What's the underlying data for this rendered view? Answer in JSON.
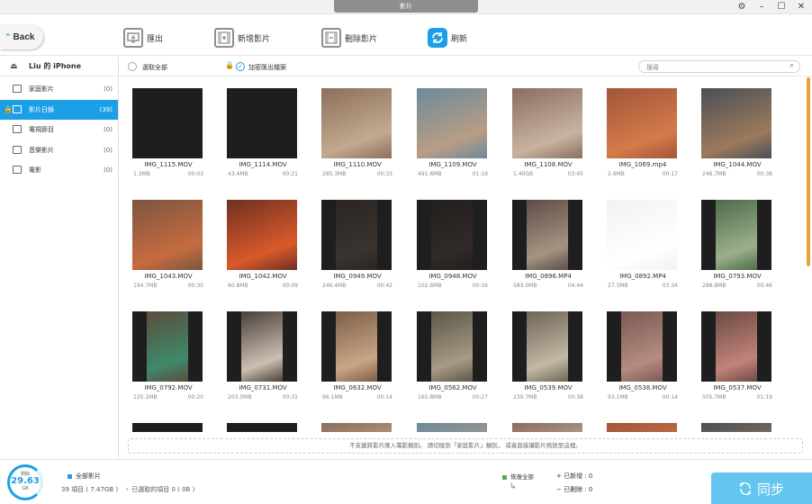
{
  "window": {
    "title": "影片"
  },
  "toolbar": {
    "back": "Back",
    "export": "匯出",
    "add": "新增影片",
    "delete": "刪除影片",
    "refresh": "刷新"
  },
  "sidebar": {
    "device": "Liu 的 iPhone",
    "items": [
      {
        "label": "家庭影片",
        "count": "(0)",
        "icon": "home-video-icon"
      },
      {
        "label": "影片日錄",
        "count": "(39)",
        "icon": "camera-roll-icon"
      },
      {
        "label": "電視節目",
        "count": "(0)",
        "icon": "tv-icon"
      },
      {
        "label": "音樂影片",
        "count": "(0)",
        "icon": "music-video-icon"
      },
      {
        "label": "電影",
        "count": "(0)",
        "icon": "movie-icon"
      }
    ]
  },
  "header": {
    "select_all": "選取全部",
    "encrypted": "加密匯出檔案",
    "search_placeholder": "搜尋"
  },
  "items": [
    {
      "name": "IMG_1115.MOV",
      "size": "1.3MB",
      "duration": "00:03"
    },
    {
      "name": "IMG_1114.MOV",
      "size": "43.4MB",
      "duration": "00:21"
    },
    {
      "name": "IMG_1110.MOV",
      "size": "285.3MB",
      "duration": "00:33"
    },
    {
      "name": "IMG_1109.MOV",
      "size": "491.6MB",
      "duration": "01:19"
    },
    {
      "name": "IMG_1108.MOV",
      "size": "1.40GB",
      "duration": "03:45"
    },
    {
      "name": "IMG_1069.mp4",
      "size": "2.9MB",
      "duration": "00:17"
    },
    {
      "name": "IMG_1044.MOV",
      "size": "246.7MB",
      "duration": "00:38"
    },
    {
      "name": "IMG_1043.MOV",
      "size": "194.7MB",
      "duration": "00:30"
    },
    {
      "name": "IMG_1042.MOV",
      "size": "60.8MB",
      "duration": "00:09"
    },
    {
      "name": "IMG_0949.MOV",
      "size": "246.4MB",
      "duration": "00:42"
    },
    {
      "name": "IMG_0948.MOV",
      "size": "102.6MB",
      "duration": "00:16"
    },
    {
      "name": "IMG_0896.MP4",
      "size": "583.0MB",
      "duration": "04:44"
    },
    {
      "name": "IMG_0892.MP4",
      "size": "27.3MB",
      "duration": "03:34"
    },
    {
      "name": "IMG_0793.MOV",
      "size": "288.8MB",
      "duration": "00:46"
    },
    {
      "name": "IMG_0792.MOV",
      "size": "125.1MB",
      "duration": "00:20"
    },
    {
      "name": "IMG_0731.MOV",
      "size": "203.0MB",
      "duration": "00:31"
    },
    {
      "name": "IMG_0632.MOV",
      "size": "96.1MB",
      "duration": "00:14"
    },
    {
      "name": "IMG_0562.MOV",
      "size": "165.8MB",
      "duration": "00:27"
    },
    {
      "name": "IMG_0539.MOV",
      "size": "239.7MB",
      "duration": "00:38"
    },
    {
      "name": "IMG_0538.MOV",
      "size": "93.1MB",
      "duration": "00:14"
    },
    {
      "name": "IMG_0537.MOV",
      "size": "505.7MB",
      "duration": "01:19"
    }
  ],
  "notice": "不支援將影片匯入電影類別。 請切換到「家庭影片」類別， 或者直接讓影片拖放至這裡。",
  "footer": {
    "storage_label": "剩餘",
    "storage_value": "29.63",
    "storage_unit": "GB",
    "all_videos": "全部影片",
    "items_summary": "39 項目 ( 7.47GB )",
    "selected_summary": "已選取的項目 0 ( 0B )",
    "restore_all": "恢復全部",
    "added": "+ 已新增 : 0",
    "deleted": "− 已刪除 : 0",
    "sync": "同步"
  },
  "colors": {
    "accent": "#1c9fe6",
    "sync": "#63c6ee",
    "scrollbar": "#e7a33d"
  }
}
